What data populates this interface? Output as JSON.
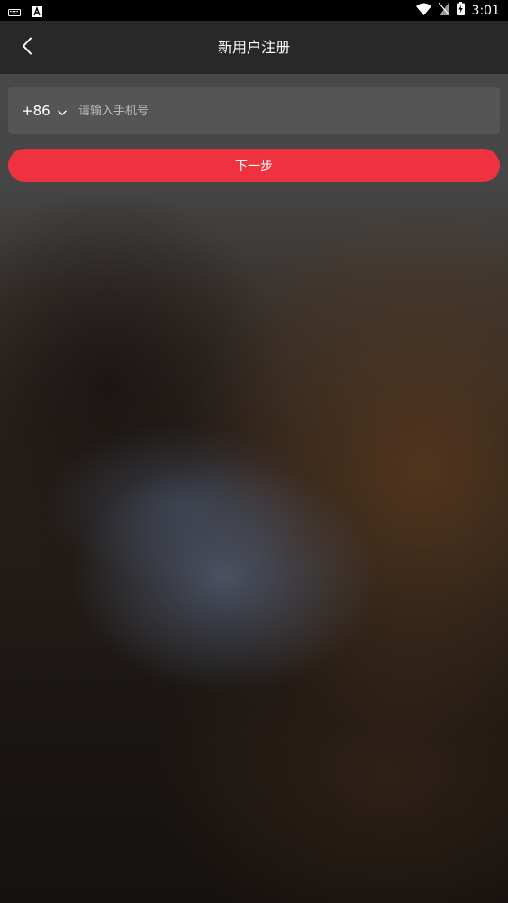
{
  "status_bar": {
    "time": "3:01",
    "left_icons": [
      "keyboard-icon",
      "a-badge-icon"
    ],
    "right_icons": [
      "wifi-icon",
      "no-sim-icon",
      "battery-charging-icon"
    ]
  },
  "header": {
    "title": "新用户注册",
    "back_icon": "chevron-left-icon"
  },
  "form": {
    "country_code": "+86",
    "country_code_icon": "chevron-down-icon",
    "phone_value": "",
    "phone_placeholder": "请输入手机号",
    "next_label": "下一步"
  },
  "colors": {
    "accent": "#ee3240",
    "app_bar": "#282828",
    "input_card": "#555555"
  }
}
